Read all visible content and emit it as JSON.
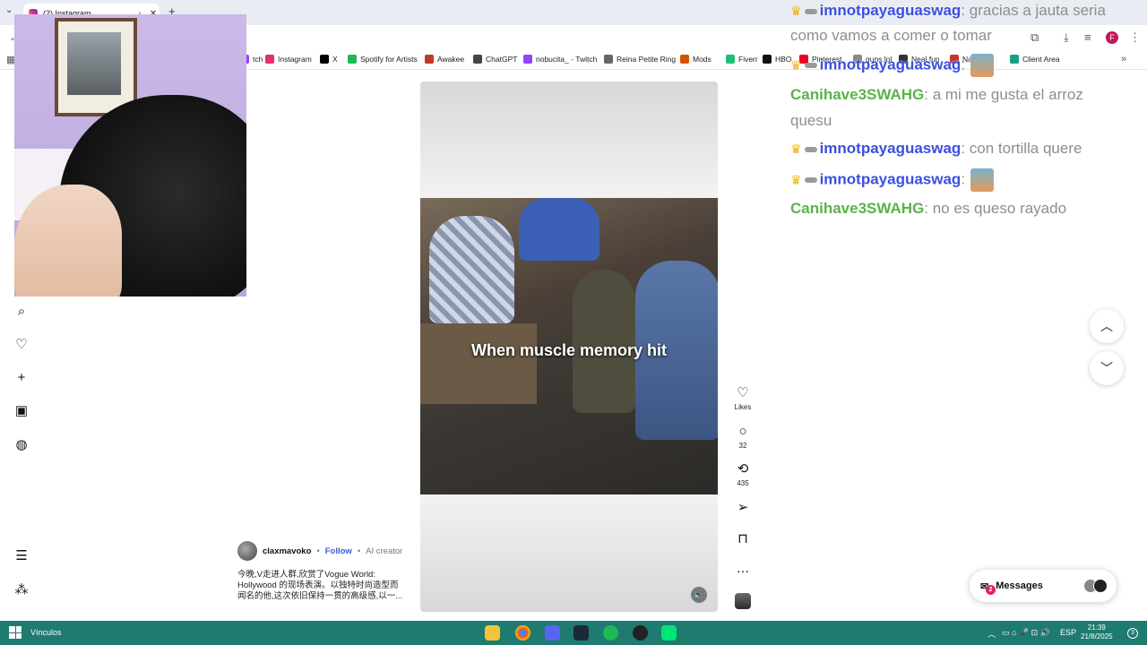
{
  "browser": {
    "tab_title": "(2) Instagram",
    "bookmarks": [
      {
        "label": "tch",
        "color": "#9146ff"
      },
      {
        "label": "Instagram",
        "color": "#e1306c"
      },
      {
        "label": "X",
        "color": "#000000"
      },
      {
        "label": "Spotify for Artists",
        "color": "#1db954"
      },
      {
        "label": "Awakee",
        "color": "#c0392b"
      },
      {
        "label": "ChatGPT",
        "color": "#444444"
      },
      {
        "label": "nobucita_ - Twitch",
        "color": "#9146ff"
      },
      {
        "label": "Reina Petite Ring",
        "color": "#666666"
      },
      {
        "label": "Mods",
        "color": "#d35400"
      },
      {
        "label": "Fiverr",
        "color": "#1dbf73"
      },
      {
        "label": "HBO",
        "color": "#111111"
      },
      {
        "label": "Pinterest",
        "color": "#e60023"
      },
      {
        "label": "guns.lol",
        "color": "#888888"
      },
      {
        "label": "Neal.fun",
        "color": "#333333"
      },
      {
        "label": "Named",
        "color": "#c0392b"
      },
      {
        "label": "Client Area",
        "color": "#16a085"
      }
    ],
    "profile_initial": "F"
  },
  "reel": {
    "caption_overlay": "When muscle memory hit",
    "likes_label": "Likes",
    "comments_count": "32",
    "reposts_count": "435",
    "creator_name": "claxmavoko",
    "follow_label": "Follow",
    "ai_label": "AI creator",
    "description": "今晚,V走进人群,欣赏了Vogue World: Hollywood 的现场表演。以独特时尚造型而闻名的他,这次依旧保持一贯的高级感,以一..."
  },
  "messages": {
    "label": "Messages",
    "badge": "2"
  },
  "chat": [
    {
      "user": "imnotpayaguaswag",
      "user_color": "blue",
      "crown": true,
      "text": ": gracias a jauta seria"
    },
    {
      "user": "",
      "user_color": "blue",
      "crown": false,
      "text": "como vamos a comer o tomar"
    },
    {
      "user": "imnotpayaguaswag",
      "user_color": "blue",
      "crown": true,
      "text": ":",
      "emote": true
    },
    {
      "user": "Canihave3SWAHG",
      "user_color": "green",
      "crown": false,
      "text": ": a mi me gusta el arroz"
    },
    {
      "user": "",
      "user_color": "green",
      "crown": false,
      "text": "quesu"
    },
    {
      "user": "imnotpayaguaswag",
      "user_color": "blue",
      "crown": true,
      "text": ": con tortilla quere"
    },
    {
      "user": "imnotpayaguaswag",
      "user_color": "blue",
      "crown": true,
      "text": ":",
      "emote": true
    },
    {
      "user": "Canihave3SWAHG",
      "user_color": "green",
      "crown": false,
      "text": ": no es queso rayado"
    }
  ],
  "taskbar": {
    "start_label": "Vínculos",
    "lang": "ESP",
    "time": "21:39",
    "date": "21/8/2025"
  }
}
